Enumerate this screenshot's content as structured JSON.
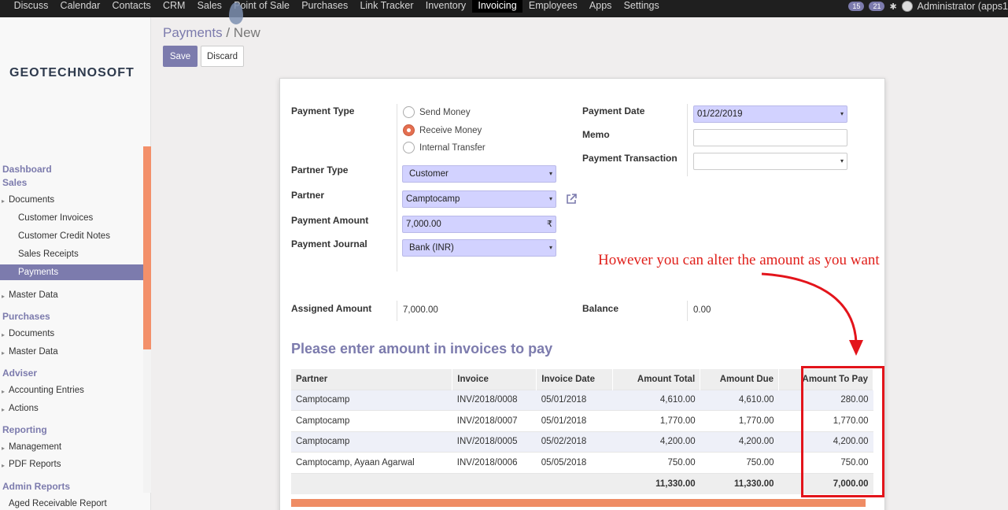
{
  "topbar": {
    "menu": [
      "Discuss",
      "Calendar",
      "Contacts",
      "CRM",
      "Sales",
      "Point of Sale",
      "Purchases",
      "Link Tracker",
      "Inventory",
      "Invoicing",
      "Employees",
      "Apps",
      "Settings"
    ],
    "active_menu": "Invoicing",
    "badge_messages": "15",
    "badge_activities": "21",
    "user": "Administrator (apps1"
  },
  "sidebar": {
    "logo": "GEOTECHNOSOFT",
    "dashboard": "Dashboard",
    "sales": "Sales",
    "sales_documents": "Documents",
    "customer_invoices": "Customer Invoices",
    "customer_credit_notes": "Customer Credit Notes",
    "sales_receipts": "Sales Receipts",
    "payments": "Payments",
    "sales_master_data": "Master Data",
    "purchases": "Purchases",
    "purchases_documents": "Documents",
    "purchases_master_data": "Master Data",
    "adviser": "Adviser",
    "accounting_entries": "Accounting Entries",
    "actions": "Actions",
    "reporting": "Reporting",
    "management": "Management",
    "pdf_reports": "PDF Reports",
    "admin_reports": "Admin Reports",
    "aged_receivable": "Aged Receivable Report"
  },
  "breadcrumb": {
    "parent": "Payments",
    "separator": "/",
    "current": "New"
  },
  "buttons": {
    "save": "Save",
    "discard": "Discard"
  },
  "form": {
    "payment_type_label": "Payment Type",
    "payment_type_options": [
      "Send Money",
      "Receive Money",
      "Internal Transfer"
    ],
    "payment_type_selected": "Receive Money",
    "partner_type_label": "Partner Type",
    "partner_type_value": "Customer",
    "partner_label": "Partner",
    "partner_value": "Camptocamp",
    "payment_amount_label": "Payment Amount",
    "payment_amount_value": "7,000.00",
    "currency_symbol": "₹",
    "payment_journal_label": "Payment Journal",
    "payment_journal_value": "Bank (INR)",
    "payment_date_label": "Payment Date",
    "payment_date_value": "01/22/2019",
    "memo_label": "Memo",
    "memo_value": "",
    "payment_transaction_label": "Payment Transaction",
    "payment_transaction_value": "",
    "assigned_amount_label": "Assigned Amount",
    "assigned_amount_value": "7,000.00",
    "balance_label": "Balance",
    "balance_value": "0.00"
  },
  "invoices_section": {
    "title": "Please enter amount in invoices to pay",
    "columns": [
      "Partner",
      "Invoice",
      "Invoice Date",
      "Amount Total",
      "Amount Due",
      "Amount To Pay"
    ],
    "rows": [
      [
        "Camptocamp",
        "INV/2018/0008",
        "05/01/2018",
        "4,610.00",
        "4,610.00",
        "280.00"
      ],
      [
        "Camptocamp",
        "INV/2018/0007",
        "05/01/2018",
        "1,770.00",
        "1,770.00",
        "1,770.00"
      ],
      [
        "Camptocamp",
        "INV/2018/0005",
        "05/02/2018",
        "4,200.00",
        "4,200.00",
        "4,200.00"
      ],
      [
        "Camptocamp, Ayaan Agarwal",
        "INV/2018/0006",
        "05/05/2018",
        "750.00",
        "750.00",
        "750.00"
      ]
    ],
    "totals": [
      "11,330.00",
      "11,330.00",
      "7,000.00"
    ]
  },
  "annotation": {
    "text": "However you can alter the amount as you want"
  },
  "colors": {
    "brand": "#7c7bad",
    "accent": "#f3906a",
    "annotation": "#e3141b",
    "required_field": "#d2d2ff"
  }
}
